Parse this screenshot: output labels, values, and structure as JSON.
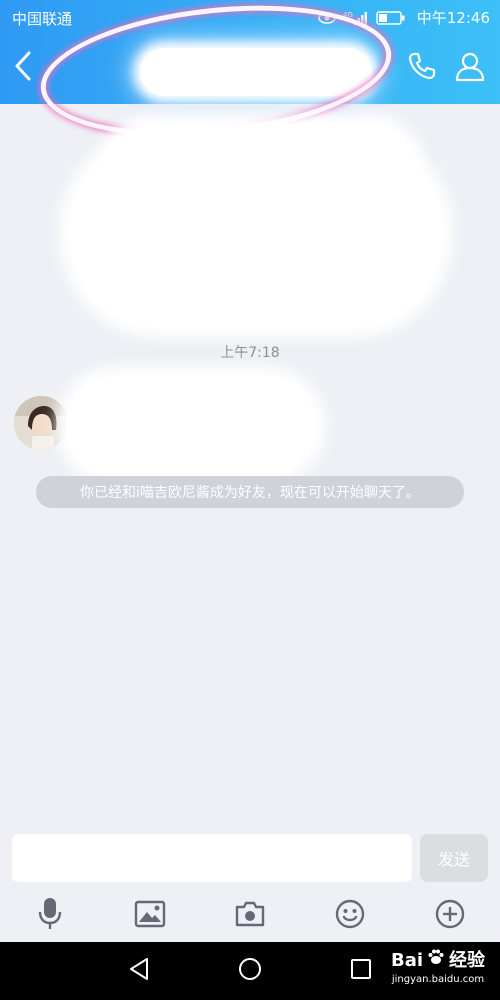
{
  "status_bar": {
    "carrier": "中国联通",
    "network": "4G",
    "time": "中午12:46"
  },
  "header": {
    "title": "",
    "icons": [
      "back-arrow-icon",
      "phone-icon",
      "profile-icon"
    ]
  },
  "chat": {
    "timestamp": "上午7:18",
    "system_notice": "你已经和i喵吉欧尼酱成为好友，现在可以开始聊天了。"
  },
  "input_bar": {
    "placeholder": "",
    "value": "",
    "send_label": "发送"
  },
  "toolbar": {
    "icons": [
      "microphone-icon",
      "image-icon",
      "camera-icon",
      "emoji-icon",
      "plus-icon"
    ]
  },
  "nav_bar": {
    "icons": [
      "nav-back-icon",
      "nav-home-icon",
      "nav-recent-icon"
    ]
  },
  "watermark": {
    "brand": "Bai",
    "brand_suffix": "经验",
    "url": "jingyan.baidu.com"
  },
  "colors": {
    "header_start": "#2f9af4",
    "header_end": "#3cc0f7",
    "chat_background": "#eef0f5",
    "notice_background": "#cfd2d8",
    "highlight_ring": "#ec6ebe"
  }
}
